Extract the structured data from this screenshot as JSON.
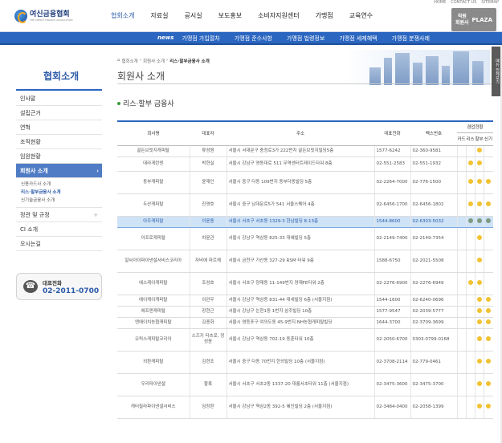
{
  "util": [
    "HOME",
    "CONTACT US",
    "SITEMAP"
  ],
  "logo": {
    "name": "여신금융협회",
    "sub": "THE CREDIT FINANCE ASSOCIATION"
  },
  "gnb": [
    "협회소개",
    "자료실",
    "공시실",
    "보도홍보",
    "소비자지원센터",
    "가맹점",
    "교육연수"
  ],
  "plaza": {
    "line1": "직원",
    "line2": "회원사",
    "label": "PLAZA"
  },
  "subnav": [
    "news",
    "가맹점 가입절차",
    "가맹점 준수사항",
    "가맹점 법령정보",
    "가맹점 세제혜택",
    "가맹점 분쟁사례"
  ],
  "sidebar": {
    "title": "협회소개",
    "items": [
      "인사말",
      "설립근거",
      "연혁",
      "조직현황",
      "임원현황",
      "회원사 소개"
    ],
    "sub_items": [
      "신용카드사 소개",
      "리스·할부금융사 소개",
      "신기술금융사 소개"
    ],
    "items_after": [
      "정관 및 규정",
      "CI 소개",
      "오시는길"
    ],
    "tel_label": "대표전화",
    "tel_number": "02-2011-0700"
  },
  "breadcrumb": [
    "협회소개",
    "회원사 소개",
    "리스·할부금융사 소개"
  ],
  "page_title": "회원사 소개",
  "section_title": "리스·할부 금융사",
  "quick_tab": "메뉴 전체보기",
  "table": {
    "headers": {
      "name": "회사명",
      "ceo": "대표자",
      "address": "주소",
      "phone": "대표전화",
      "fax": "팩스번호",
      "biz": "겸업현황"
    },
    "biz_cols": [
      "카드",
      "리스",
      "할부",
      "신기"
    ],
    "rows": [
      {
        "name": "골든브릿지캐피탈",
        "ceo": "류성원",
        "address": "서울시 서대문구 충정로3가 222번지 골든브릿지빌딩5층",
        "phone": "1577-6242",
        "fax": "02-360-9581",
        "biz": [
          false,
          false,
          true,
          false
        ]
      },
      {
        "name": "데라게란덴",
        "ceo": "박현실",
        "address": "서울시 강남구 영동대로 511 무역센터트레이드타워 8층",
        "phone": "02-551-2583",
        "fax": "02-551-1932",
        "biz": [
          false,
          true,
          true,
          false
        ]
      },
      {
        "name": "동부캐피탈",
        "ceo": "윤재인",
        "address": "서울시 중구 다동 109번지 동부다동빌딩 5층",
        "phone": "02-2264-7000",
        "fax": "02-776-1500",
        "biz": [
          false,
          true,
          true,
          true
        ]
      },
      {
        "name": "두산캐피탈",
        "ceo": "진영호",
        "address": "서울시 중구 남대문로5가 541 서울스퀘어 4층",
        "phone": "02-6456-1700",
        "fax": "02-6456-1802",
        "biz": [
          false,
          true,
          true,
          true
        ]
      },
      {
        "name": "아주캐피탈",
        "ceo": "이윤종",
        "address": "서울시 서초구 서초동 1329-3 한남빌딩 8-13층",
        "phone": "1544-8600",
        "fax": "02-6303-5032",
        "biz": [
          false,
          true,
          true,
          true
        ],
        "highlight": true
      },
      {
        "name": "아프로캐피탈",
        "ceo": "차윤관",
        "address": "서울시 강남구 역삼동 825-33 대혜빌딩 5층",
        "phone": "02-2149-7400",
        "fax": "02-2149-7354",
        "biz": [
          false,
          false,
          true,
          false
        ]
      },
      {
        "name": "알씨아이파이낸셜서비스코리아",
        "ceo": "자비에 마르체",
        "address": "서울시 금천구 가산동 327-29 RSM 타워 9층",
        "phone": "1588-6750",
        "fax": "02-2021-5508",
        "biz": [
          false,
          false,
          true,
          false
        ]
      },
      {
        "name": "에스케이캐피탈",
        "ceo": "조성호",
        "address": "서울시 서초구 양재동 11-149번지 양재FE타워 2층",
        "phone": "02-2276-6900",
        "fax": "02-2276-6949",
        "biz": [
          false,
          true,
          true,
          false
        ]
      },
      {
        "name": "에이케이캐피탈",
        "ceo": "이완우",
        "address": "서울시 강남구 역삼동 831-44 대세빌딩 6층 (서울지점)",
        "phone": "1544-1600",
        "fax": "02-6240-0696",
        "biz": [
          false,
          false,
          true,
          true
        ]
      },
      {
        "name": "에프앤캐피탈",
        "ceo": "장현근",
        "address": "서울시 강남구 논현1동 1번지 삼주빌딩 10층",
        "phone": "1577-9547",
        "fax": "02-2039-5777",
        "biz": [
          false,
          false,
          true,
          true
        ]
      },
      {
        "name": "엔에이치농협캐피탈",
        "ceo": "김종화",
        "address": "서울시 영등포구 여의도동 45-9번지 NH농협캐피탈빌딩",
        "phone": "1644-3700",
        "fax": "02-3709-3699",
        "biz": [
          false,
          false,
          true,
          true
        ]
      },
      {
        "name": "오릭스캐피탈코리아",
        "ceo": "스즈키 타츠로, 정성윤",
        "address": "서울시 강남구 역삼동 702-19 동훈타워 10층",
        "phone": "02-2050-6700",
        "fax": "0303-0799-0168",
        "biz": [
          false,
          false,
          true,
          true
        ]
      },
      {
        "name": "외환캐피탈",
        "ceo": "김현조",
        "address": "서울시 중구 다동 70번지 한외빌딩 10층 (서울지점)",
        "phone": "02-3708-2114",
        "fax": "02-779-0461",
        "biz": [
          false,
          false,
          true,
          true
        ]
      },
      {
        "name": "우리파이낸셜",
        "ceo": "황록",
        "address": "서울시 서초구 서초2동 1337-20 대륭서초타워 11층 (서울지점)",
        "phone": "02-3475-3600",
        "fax": "02-3475-3700",
        "biz": [
          false,
          false,
          true,
          true
        ]
      },
      {
        "name": "캐터필라파이낸셜서비스",
        "ceo": "임장환",
        "address": "서울시 강남구 역삼2동 392-5 혜인빌딩 2층 (서울지점)",
        "phone": "02-3484-0400",
        "fax": "02-2058-1399",
        "biz": [
          false,
          false,
          true,
          true
        ]
      }
    ]
  }
}
